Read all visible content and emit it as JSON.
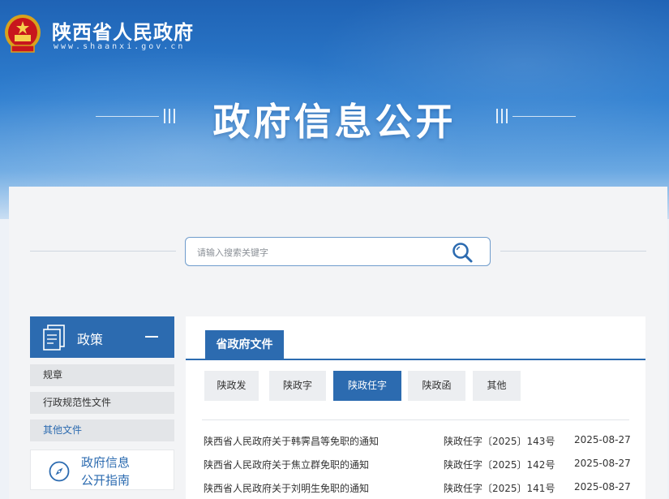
{
  "colors": {
    "primary": "#2c6bb0",
    "banner_top": "#1f63b5",
    "banner_bottom": "#c9def3"
  },
  "header": {
    "logo_icon": "national-emblem-icon",
    "site_name": "陕西省人民政府",
    "site_url": "www.shaanxi.gov.cn",
    "hero_title": "政府信息公开"
  },
  "search": {
    "placeholder": "请输入搜索关键字",
    "value": "",
    "icon": "search-icon"
  },
  "sidebar": {
    "section_title": "政策",
    "section_icon": "document-stack-icon",
    "collapse_icon": "minus-icon",
    "items": [
      {
        "label": "规章"
      },
      {
        "label": "行政规范性文件"
      },
      {
        "label": "其他文件"
      }
    ],
    "guide_icon": "compass-icon",
    "guide_line1": "政府信息",
    "guide_line2": "公开指南"
  },
  "content": {
    "active_tab": "省政府文件",
    "subtabs": [
      {
        "label": "陕政发"
      },
      {
        "label": "陕政字"
      },
      {
        "label": "陕政任字"
      },
      {
        "label": "陕政函"
      },
      {
        "label": "其他"
      }
    ],
    "active_subtab_index": 2,
    "documents": [
      {
        "title": "陕西省人民政府关于韩霁昌等免职的通知",
        "number": "陕政任字〔2025〕143号",
        "date": "2025-08-27"
      },
      {
        "title": "陕西省人民政府关于焦立群免职的通知",
        "number": "陕政任字〔2025〕142号",
        "date": "2025-08-27"
      },
      {
        "title": "陕西省人民政府关于刘明生免职的通知",
        "number": "陕政任字〔2025〕141号",
        "date": "2025-08-27"
      }
    ]
  }
}
